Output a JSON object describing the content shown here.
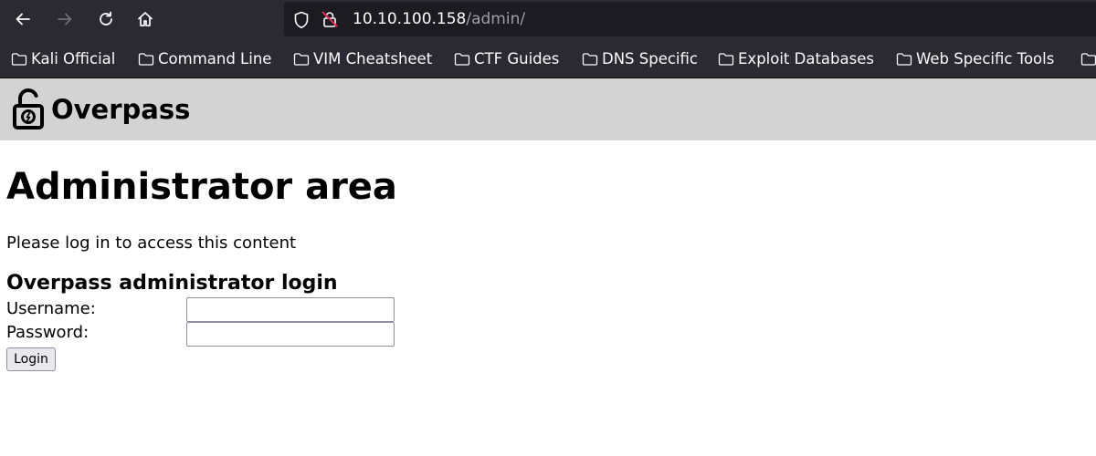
{
  "browser": {
    "url": {
      "host": "10.10.100.158",
      "path": "/admin/"
    },
    "nav_icons": [
      "back-arrow-icon",
      "forward-arrow-icon",
      "reload-icon",
      "home-icon"
    ],
    "bookmarks": [
      {
        "label": "Kali Official"
      },
      {
        "label": "Command Line"
      },
      {
        "label": "VIM Cheatsheet"
      },
      {
        "label": "CTF Guides"
      },
      {
        "label": "DNS Specific"
      },
      {
        "label": "Exploit Databases"
      },
      {
        "label": "Web Specific Tools"
      }
    ],
    "colors": {
      "chrome_bg": "#2b2a33",
      "urlbar_bg": "#1c1b22",
      "insecure_red": "#e22850"
    }
  },
  "site": {
    "name": "Overpass",
    "logo_icon": "open-padlock-icon",
    "header_bg": "#d3d3d3"
  },
  "page": {
    "title": "Administrator area",
    "subtitle": "Please log in to access this content",
    "login": {
      "heading": "Overpass administrator login",
      "username_label": "Username:",
      "username_value": "",
      "password_label": "Password:",
      "password_value": "",
      "submit_label": "Login"
    }
  }
}
